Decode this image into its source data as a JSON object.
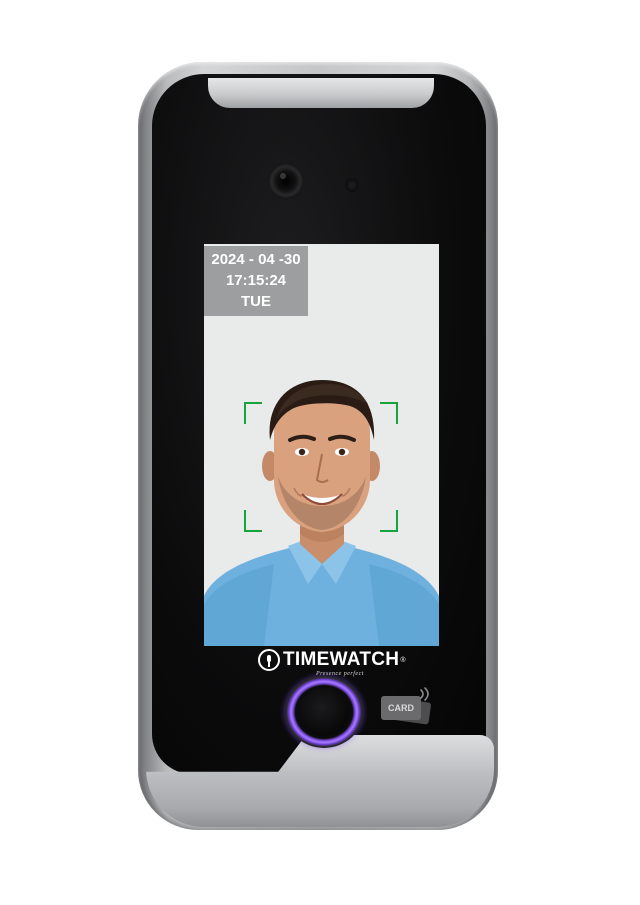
{
  "device": {
    "brand": "TIMEWATCH",
    "registered_mark": "®",
    "tagline": "Presence perfect"
  },
  "screen": {
    "date": "2024 - 04 -30",
    "time": "17:15:24",
    "weekday": "TUE",
    "face_frame_color": "#16a33b"
  },
  "card_reader": {
    "label": "CARD",
    "icon": "nfc-icon"
  },
  "fingerprint_reader": {
    "icon": "fingerprint-sensor",
    "ring_color": "#8b5cf6"
  },
  "colors": {
    "clock_panel_bg": "#9d9e9f",
    "shirt": "#6fb1de",
    "device_face": "#0b0b0c"
  }
}
